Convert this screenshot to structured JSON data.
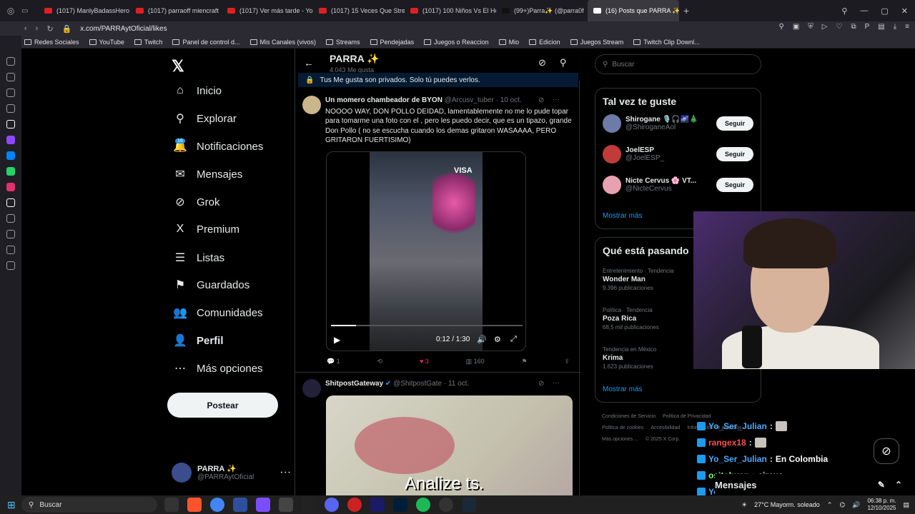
{
  "browser": {
    "tabs": [
      {
        "label": "(1017) ManlyBadassHero",
        "color": "#e02020"
      },
      {
        "label": "(1017) parraoff miencraft",
        "color": "#e02020"
      },
      {
        "label": "(1017) Ver más tarde - Yo",
        "color": "#e02020"
      },
      {
        "label": "(1017) 15 Veces Que Strea",
        "color": "#e02020"
      },
      {
        "label": "(1017) 100 Niños Vs El Ho",
        "color": "#e02020"
      },
      {
        "label": "(99+)Parra✨ (@parra0f",
        "color": "#111111"
      },
      {
        "label": "(16) Posts que PARRA ✨",
        "color": "#ffffff",
        "active": true
      }
    ],
    "url": "x.com/PARRAytOficial/likes",
    "bookmarks": [
      "Redes Sociales",
      "YouTube",
      "Twitch",
      "Panel de control d...",
      "Mis Canales (vivos)",
      "Streams",
      "Pendejadas",
      "Juegos o Reaccion",
      "Mio",
      "Edicion",
      "Juegos Stream",
      "Twitch Clip Downl..."
    ]
  },
  "nav": {
    "items": [
      {
        "label": "Inicio",
        "icon": "home-icon",
        "glyph": "⌂"
      },
      {
        "label": "Explorar",
        "icon": "search-icon",
        "glyph": "⚲"
      },
      {
        "label": "Notificaciones",
        "icon": "bell-icon",
        "glyph": "🔔"
      },
      {
        "label": "Mensajes",
        "icon": "mail-icon",
        "glyph": "✉"
      },
      {
        "label": "Grok",
        "icon": "grok-icon",
        "glyph": "⊘"
      },
      {
        "label": "Premium",
        "icon": "x-premium-icon",
        "glyph": "X"
      },
      {
        "label": "Listas",
        "icon": "list-icon",
        "glyph": "☰"
      },
      {
        "label": "Guardados",
        "icon": "bookmark-icon",
        "glyph": "⚑"
      },
      {
        "label": "Comunidades",
        "icon": "communities-icon",
        "glyph": "👥"
      },
      {
        "label": "Perfil",
        "icon": "profile-icon",
        "glyph": "👤"
      },
      {
        "label": "Más opciones",
        "icon": "more-icon",
        "glyph": "⋯"
      }
    ],
    "notif_badge": "16",
    "post_button": "Postear",
    "account": {
      "name": "PARRA ✨",
      "handle": "@PARRAytOficial"
    }
  },
  "header": {
    "name": "PARRA ✨",
    "likes_count": "4.043 Me gusta",
    "private_note": "Tus Me gusta son privados. Solo tú puedes verlos."
  },
  "tweets": [
    {
      "author": "Un momero chambeador de BYON",
      "handle": "@Arcusv_tuber",
      "date": "10 oct.",
      "text": "NOOOO WAY, DON POLLO DEIDAD, lamentablemente no me lo pude topar para tomarme una foto con el , pero les puedo decir, que es un tipazo, grande Don Pollo ( no se escucha cuando los demas gritaron WASAAAA, PERO GRITARON FUERTISIMO)",
      "video_time": "0:12 / 1:30",
      "video_progress": 0.13,
      "replies": "1",
      "likes": "3",
      "views": "160"
    },
    {
      "author": "ShitpostGateway",
      "handle": "@ShitpostGate",
      "date": "11 oct.",
      "video_caption": "Analize ts."
    }
  ],
  "sidebar": {
    "search_placeholder": "Buscar",
    "who_to_follow_title": "Tal vez te guste",
    "suggestions": [
      {
        "name": "Shirogane 🎙️🎧🌌🎄",
        "handle": "@ShiroganeAol",
        "button": "Seguir"
      },
      {
        "name": "JoelESP",
        "handle": "@JoelESP_",
        "button": "Seguir"
      },
      {
        "name": "Nicte Cervus 🌸 VT...",
        "handle": "@NicteCervus",
        "button": "Seguir"
      }
    ],
    "show_more": "Mostrar más",
    "trends_title": "Qué está pasando",
    "trends": [
      {
        "meta": "Entretenimiento · Tendencia",
        "name": "Wonder Man",
        "count": "9.396 publicaciones"
      },
      {
        "meta": "Política · Tendencia",
        "name": "Poza Rica",
        "count": "68,5 mil publicaciones"
      },
      {
        "meta": "Tendencia en México",
        "name": "Krima",
        "count": "1.623 publicaciones"
      }
    ],
    "trends_more": "Mostrar más",
    "footer": [
      "Condiciones de Servicio",
      "Política de Privacidad",
      "Política de cookies",
      "Accesibilidad",
      "Información de anuncios",
      "Más opciones ...",
      "© 2025 X Corp."
    ]
  },
  "chat": [
    {
      "user": "Yo_Ser_Julian",
      "msg": "",
      "color": "#4aa8ff",
      "emote": true
    },
    {
      "user": "rangex18",
      "msg": "",
      "color": "#ff4d4d",
      "emote": true
    },
    {
      "user": "Yo_Ser_Julian",
      "msg": "En Colombia",
      "color": "#4aa8ff",
      "emote": false
    },
    {
      "user": "ositobyon",
      "msg": "circus",
      "color": "#7dff7d",
      "emote": false
    },
    {
      "user": "Yo_Ser_Julian",
      "msg": "",
      "color": "#4aa8ff",
      "emote": true
    }
  ],
  "messages_drawer": "Mensajes",
  "taskbar": {
    "search": "Buscar",
    "weather": "27°C  Mayorm. soleado",
    "time": "06:38 p. m.",
    "date": "12/10/2025"
  }
}
